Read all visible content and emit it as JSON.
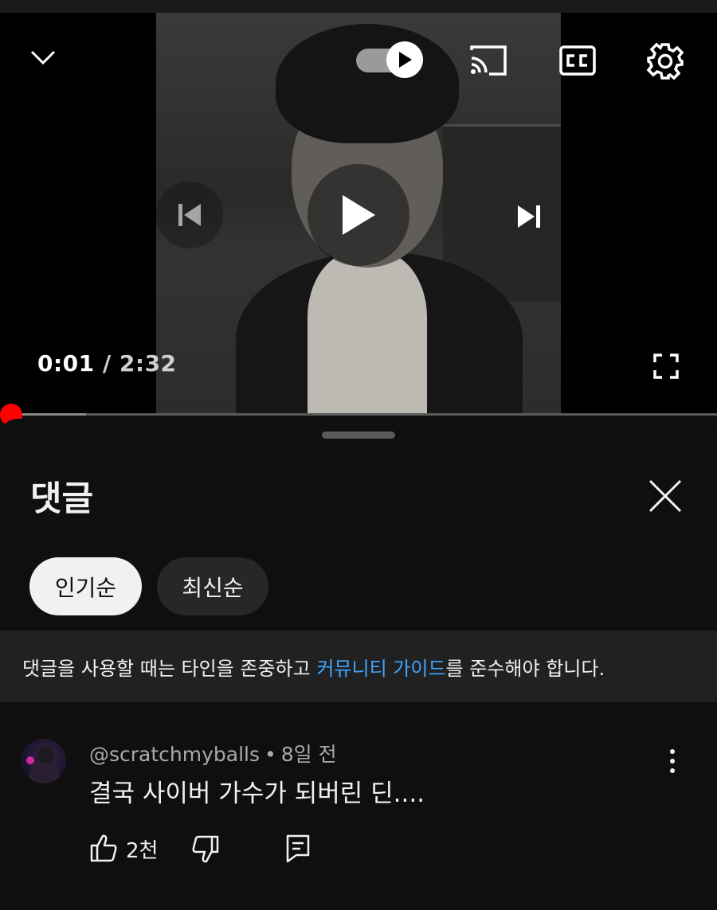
{
  "player": {
    "time_current": "0:01",
    "time_separator": "/",
    "time_duration": "2:32",
    "progress_fraction": 0.0066,
    "icons": [
      "chevron-down-icon",
      "autoplay-toggle",
      "cast-icon",
      "cc-icon",
      "gear-icon",
      "previous-icon",
      "play-icon",
      "next-icon",
      "fullscreen-icon"
    ]
  },
  "comments": {
    "title": "댓글",
    "chips": [
      "인기순",
      "최신순"
    ],
    "notice": {
      "before": "댓글을 사용할 때는 타인을 존중하고 ",
      "link": "커뮤니티 가이드",
      "after": "를 준수해야 합니다."
    },
    "items": [
      {
        "author": "@scratchmyballs",
        "dot": "•",
        "age": "8일 전",
        "text": "결국 사이버 가수가 되버린 딘....",
        "likes": "2천"
      }
    ]
  },
  "colors": {
    "background": "#0f0f0f",
    "accent_red": "#ff0000",
    "link_blue": "#3ea6ff",
    "chip_active": "#f1f1f1",
    "chip_inactive": "#272727"
  }
}
